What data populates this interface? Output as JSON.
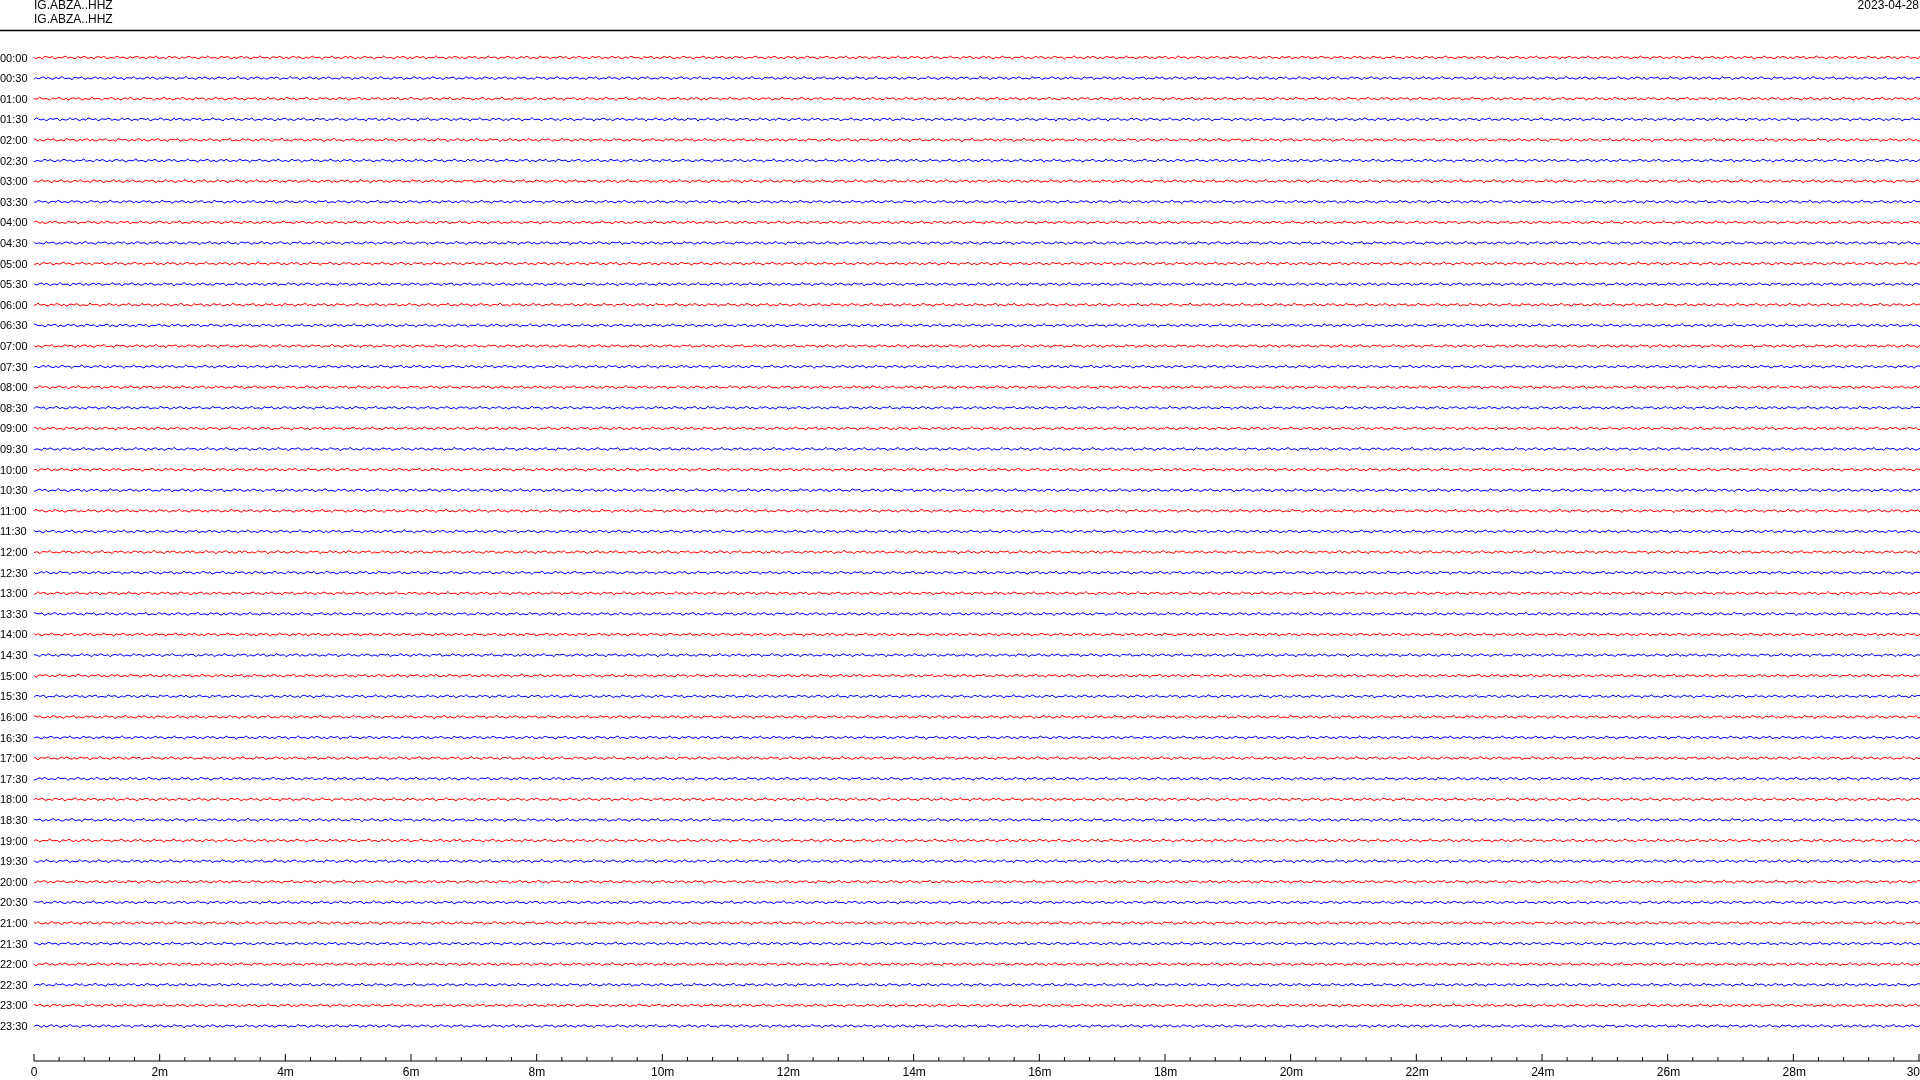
{
  "header": {
    "station_lines": [
      "IG.ABZA..HHZ",
      "IG.ABZA..HHZ"
    ],
    "date": "2023-04-28"
  },
  "rows": [
    {
      "label": "00:00",
      "color": "#ff0000"
    },
    {
      "label": "00:30",
      "color": "#0000ff"
    },
    {
      "label": "01:00",
      "color": "#ff0000"
    },
    {
      "label": "01:30",
      "color": "#0000ff"
    },
    {
      "label": "02:00",
      "color": "#ff0000"
    },
    {
      "label": "02:30",
      "color": "#0000ff"
    },
    {
      "label": "03:00",
      "color": "#ff0000"
    },
    {
      "label": "03:30",
      "color": "#0000ff"
    },
    {
      "label": "04:00",
      "color": "#ff0000"
    },
    {
      "label": "04:30",
      "color": "#0000ff"
    },
    {
      "label": "05:00",
      "color": "#ff0000"
    },
    {
      "label": "05:30",
      "color": "#0000ff"
    },
    {
      "label": "06:00",
      "color": "#ff0000"
    },
    {
      "label": "06:30",
      "color": "#0000ff"
    },
    {
      "label": "07:00",
      "color": "#ff0000"
    },
    {
      "label": "07:30",
      "color": "#0000ff"
    },
    {
      "label": "08:00",
      "color": "#ff0000"
    },
    {
      "label": "08:30",
      "color": "#0000ff"
    },
    {
      "label": "09:00",
      "color": "#ff0000"
    },
    {
      "label": "09:30",
      "color": "#0000ff"
    },
    {
      "label": "10:00",
      "color": "#ff0000"
    },
    {
      "label": "10:30",
      "color": "#0000ff"
    },
    {
      "label": "11:00",
      "color": "#ff0000"
    },
    {
      "label": "11:30",
      "color": "#0000ff"
    },
    {
      "label": "12:00",
      "color": "#ff0000"
    },
    {
      "label": "12:30",
      "color": "#0000ff"
    },
    {
      "label": "13:00",
      "color": "#ff0000"
    },
    {
      "label": "13:30",
      "color": "#0000ff"
    },
    {
      "label": "14:00",
      "color": "#ff0000"
    },
    {
      "label": "14:30",
      "color": "#0000ff"
    },
    {
      "label": "15:00",
      "color": "#ff0000"
    },
    {
      "label": "15:30",
      "color": "#0000ff"
    },
    {
      "label": "16:00",
      "color": "#ff0000"
    },
    {
      "label": "16:30",
      "color": "#0000ff"
    },
    {
      "label": "17:00",
      "color": "#ff0000"
    },
    {
      "label": "17:30",
      "color": "#0000ff"
    },
    {
      "label": "18:00",
      "color": "#ff0000"
    },
    {
      "label": "18:30",
      "color": "#0000ff"
    },
    {
      "label": "19:00",
      "color": "#ff0000"
    },
    {
      "label": "19:30",
      "color": "#0000ff"
    },
    {
      "label": "20:00",
      "color": "#ff0000"
    },
    {
      "label": "20:30",
      "color": "#0000ff"
    },
    {
      "label": "21:00",
      "color": "#ff0000"
    },
    {
      "label": "21:30",
      "color": "#0000ff"
    },
    {
      "label": "22:00",
      "color": "#ff0000"
    },
    {
      "label": "22:30",
      "color": "#0000ff"
    },
    {
      "label": "23:00",
      "color": "#ff0000"
    },
    {
      "label": "23:30",
      "color": "#0000ff"
    }
  ],
  "time_axis": {
    "tick_labels": [
      "0",
      "2m",
      "4m",
      "6m",
      "8m",
      "10m",
      "12m",
      "14m",
      "16m",
      "18m",
      "20m",
      "22m",
      "24m",
      "26m",
      "28m",
      "30"
    ]
  }
}
